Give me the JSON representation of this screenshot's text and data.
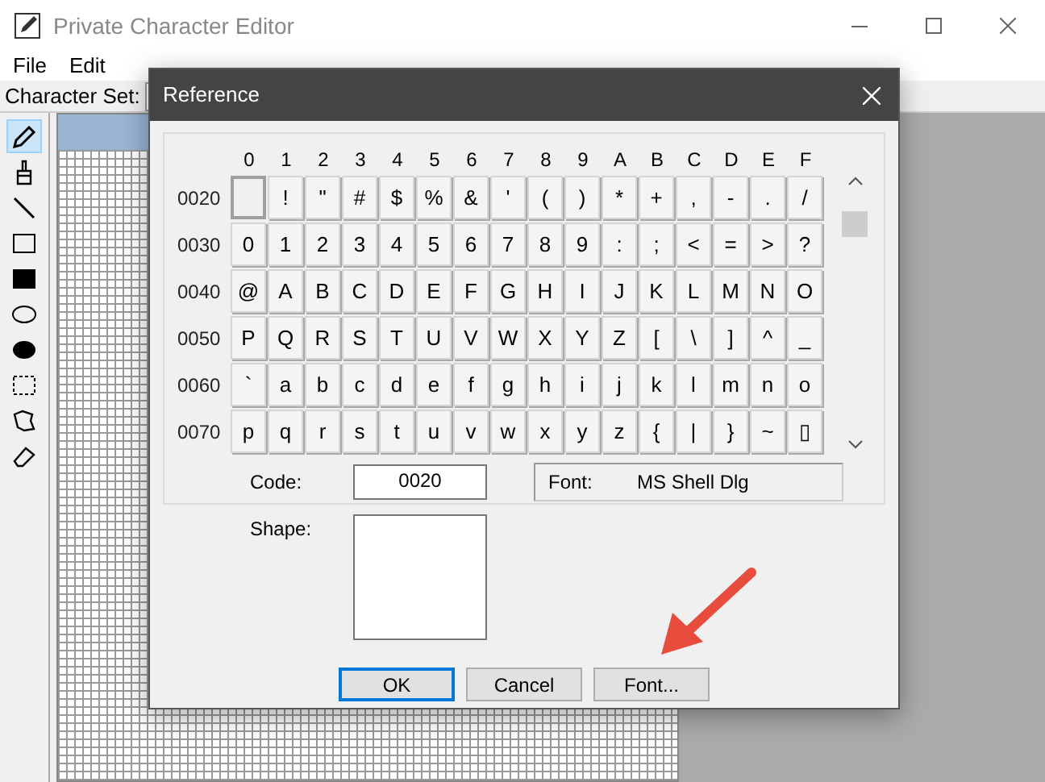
{
  "window": {
    "title": "Private Character Editor"
  },
  "menu": [
    {
      "label": "File"
    },
    {
      "label": "Edit"
    }
  ],
  "toolbar": {
    "label": "Character Set:"
  },
  "tools": [
    {
      "kind": "pencil",
      "selected": true
    },
    {
      "kind": "brush",
      "selected": false
    },
    {
      "kind": "line",
      "selected": false
    },
    {
      "kind": "rect",
      "selected": false
    },
    {
      "kind": "filled-rect",
      "selected": false
    },
    {
      "kind": "ellipse",
      "selected": false
    },
    {
      "kind": "filled-ellipse",
      "selected": false
    },
    {
      "kind": "rect-select",
      "selected": false
    },
    {
      "kind": "free-select",
      "selected": false
    },
    {
      "kind": "eraser",
      "selected": false
    }
  ],
  "dialog": {
    "title": "Reference",
    "columns": [
      "0",
      "1",
      "2",
      "3",
      "4",
      "5",
      "6",
      "7",
      "8",
      "9",
      "A",
      "B",
      "C",
      "D",
      "E",
      "F"
    ],
    "rows": [
      {
        "label": "0020",
        "cells": [
          {
            "selected": true
          },
          {
            "char": "!",
            "selected": false
          },
          {
            "char": "\"",
            "selected": false
          },
          {
            "char": "#",
            "selected": false
          },
          {
            "char": "$",
            "selected": false
          },
          {
            "char": "%",
            "selected": false
          },
          {
            "char": "&",
            "selected": false
          },
          {
            "char": "'",
            "selected": false
          },
          {
            "char": "(",
            "selected": false
          },
          {
            "char": ")",
            "selected": false
          },
          {
            "char": "*",
            "selected": false
          },
          {
            "char": "+",
            "selected": false
          },
          {
            "char": ",",
            "selected": false
          },
          {
            "char": "-",
            "selected": false
          },
          {
            "char": ".",
            "selected": false
          },
          {
            "char": "/",
            "selected": false
          }
        ]
      },
      {
        "label": "0030",
        "cells": [
          {
            "char": "0",
            "selected": false
          },
          {
            "char": "1",
            "selected": false
          },
          {
            "char": "2",
            "selected": false
          },
          {
            "char": "3",
            "selected": false
          },
          {
            "char": "4",
            "selected": false
          },
          {
            "char": "5",
            "selected": false
          },
          {
            "char": "6",
            "selected": false
          },
          {
            "char": "7",
            "selected": false
          },
          {
            "char": "8",
            "selected": false
          },
          {
            "char": "9",
            "selected": false
          },
          {
            "char": ":",
            "selected": false
          },
          {
            "char": ";",
            "selected": false
          },
          {
            "char": "<",
            "selected": false
          },
          {
            "char": "=",
            "selected": false
          },
          {
            "char": ">",
            "selected": false
          },
          {
            "char": "?",
            "selected": false
          }
        ]
      },
      {
        "label": "0040",
        "cells": [
          {
            "char": "@",
            "selected": false
          },
          {
            "char": "A",
            "selected": false
          },
          {
            "char": "B",
            "selected": false
          },
          {
            "char": "C",
            "selected": false
          },
          {
            "char": "D",
            "selected": false
          },
          {
            "char": "E",
            "selected": false
          },
          {
            "char": "F",
            "selected": false
          },
          {
            "char": "G",
            "selected": false
          },
          {
            "char": "H",
            "selected": false
          },
          {
            "char": "I",
            "selected": false
          },
          {
            "char": "J",
            "selected": false
          },
          {
            "char": "K",
            "selected": false
          },
          {
            "char": "L",
            "selected": false
          },
          {
            "char": "M",
            "selected": false
          },
          {
            "char": "N",
            "selected": false
          },
          {
            "char": "O",
            "selected": false
          }
        ]
      },
      {
        "label": "0050",
        "cells": [
          {
            "char": "P",
            "selected": false
          },
          {
            "char": "Q",
            "selected": false
          },
          {
            "char": "R",
            "selected": false
          },
          {
            "char": "S",
            "selected": false
          },
          {
            "char": "T",
            "selected": false
          },
          {
            "char": "U",
            "selected": false
          },
          {
            "char": "V",
            "selected": false
          },
          {
            "char": "W",
            "selected": false
          },
          {
            "char": "X",
            "selected": false
          },
          {
            "char": "Y",
            "selected": false
          },
          {
            "char": "Z",
            "selected": false
          },
          {
            "char": "[",
            "selected": false
          },
          {
            "char": "\\",
            "selected": false
          },
          {
            "char": "]",
            "selected": false
          },
          {
            "char": "^",
            "selected": false
          },
          {
            "char": "_",
            "selected": false
          }
        ]
      },
      {
        "label": "0060",
        "cells": [
          {
            "char": "`",
            "selected": false
          },
          {
            "char": "a",
            "selected": false
          },
          {
            "char": "b",
            "selected": false
          },
          {
            "char": "c",
            "selected": false
          },
          {
            "char": "d",
            "selected": false
          },
          {
            "char": "e",
            "selected": false
          },
          {
            "char": "f",
            "selected": false
          },
          {
            "char": "g",
            "selected": false
          },
          {
            "char": "h",
            "selected": false
          },
          {
            "char": "i",
            "selected": false
          },
          {
            "char": "j",
            "selected": false
          },
          {
            "char": "k",
            "selected": false
          },
          {
            "char": "l",
            "selected": false
          },
          {
            "char": "m",
            "selected": false
          },
          {
            "char": "n",
            "selected": false
          },
          {
            "char": "o",
            "selected": false
          }
        ]
      },
      {
        "label": "0070",
        "cells": [
          {
            "char": "p",
            "selected": false
          },
          {
            "char": "q",
            "selected": false
          },
          {
            "char": "r",
            "selected": false
          },
          {
            "char": "s",
            "selected": false
          },
          {
            "char": "t",
            "selected": false
          },
          {
            "char": "u",
            "selected": false
          },
          {
            "char": "v",
            "selected": false
          },
          {
            "char": "w",
            "selected": false
          },
          {
            "char": "x",
            "selected": false
          },
          {
            "char": "y",
            "selected": false
          },
          {
            "char": "z",
            "selected": false
          },
          {
            "char": "{",
            "selected": false
          },
          {
            "char": "|",
            "selected": false
          },
          {
            "char": "}",
            "selected": false
          },
          {
            "char": "~",
            "selected": false
          },
          {
            "char": "▯",
            "selected": false
          }
        ]
      }
    ],
    "code": {
      "label": "Code:",
      "value": "0020"
    },
    "font": {
      "label": "Font:",
      "value": "MS Shell Dlg"
    },
    "shape": {
      "label": "Shape:"
    },
    "buttons": [
      {
        "label": "OK",
        "default": true
      },
      {
        "label": "Cancel",
        "default": false
      },
      {
        "label": "Font...",
        "default": false
      }
    ]
  }
}
